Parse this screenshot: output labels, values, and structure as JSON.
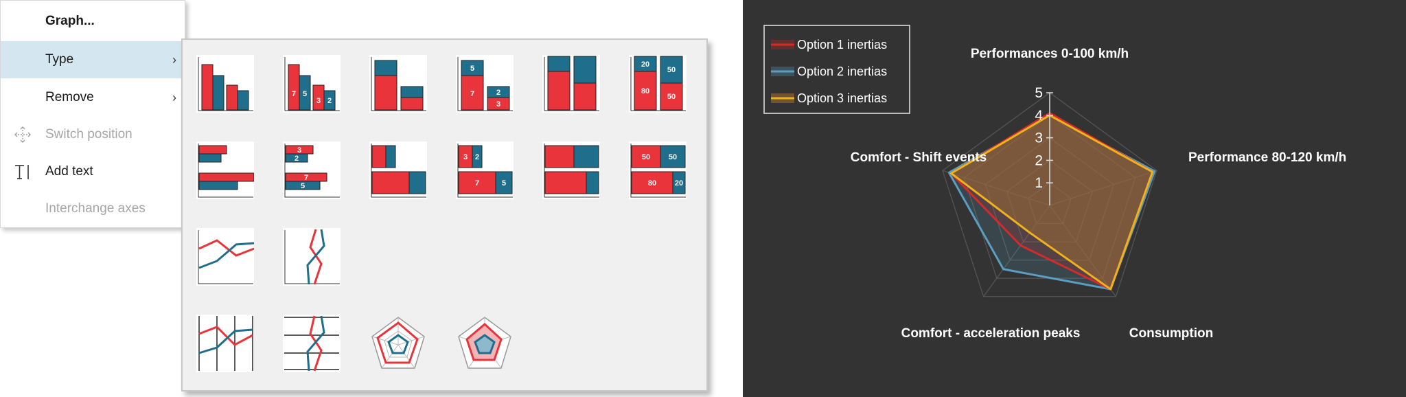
{
  "menu": {
    "items": [
      {
        "label": "Graph...",
        "name": "graph-menu-item"
      },
      {
        "label": "Type",
        "name": "type-menu-item"
      },
      {
        "label": "Remove",
        "name": "remove-menu-item"
      },
      {
        "label": "Switch position",
        "name": "switch-position-menu-item"
      },
      {
        "label": "Add text",
        "name": "add-text-menu-item"
      },
      {
        "label": "Interchange axes",
        "name": "interchange-axes-menu-item"
      }
    ],
    "submenu_arrow": "›",
    "icons": {
      "switch_position": "move-arrows-icon",
      "add_text": "text-cursor-icon",
      "submenu": "chevron-right-icon"
    }
  },
  "type_submenu": {
    "thumbnails": [
      {
        "name": "grouped-column-chart-type",
        "labels": []
      },
      {
        "name": "grouped-column-labeled-chart-type",
        "labels": [
          "7",
          "5",
          "3",
          "2"
        ]
      },
      {
        "name": "stacked-column-chart-type",
        "labels": []
      },
      {
        "name": "stacked-column-labeled-chart-type",
        "labels": [
          "5",
          "7",
          "2",
          "3"
        ]
      },
      {
        "name": "stacked-column-100-chart-type",
        "labels": []
      },
      {
        "name": "stacked-column-100-labeled-chart-type",
        "labels": [
          "20",
          "80",
          "50",
          "50"
        ]
      },
      {
        "name": "grouped-bar-chart-type",
        "labels": []
      },
      {
        "name": "grouped-bar-labeled-chart-type",
        "labels": [
          "3",
          "2",
          "7",
          "5"
        ]
      },
      {
        "name": "stacked-bar-chart-type",
        "labels": []
      },
      {
        "name": "stacked-bar-labeled-chart-type",
        "labels": [
          "3",
          "2",
          "7",
          "5"
        ]
      },
      {
        "name": "stacked-bar-100-chart-type",
        "labels": []
      },
      {
        "name": "stacked-bar-100-labeled-chart-type",
        "labels": [
          "50",
          "50",
          "80",
          "20"
        ]
      },
      {
        "name": "line-chart-type",
        "labels": []
      },
      {
        "name": "vertical-line-chart-type",
        "labels": []
      },
      {
        "name": "parallel-coordinates-chart-type",
        "labels": []
      },
      {
        "name": "vertical-parallel-coordinates-chart-type",
        "labels": []
      },
      {
        "name": "radar-chart-type",
        "labels": []
      },
      {
        "name": "filled-radar-chart-type",
        "labels": []
      }
    ]
  },
  "colors": {
    "red": "#e8343a",
    "blue": "#1f6e8c",
    "panel_bg": "#333333",
    "option1": "#d42a2a",
    "option2": "#5a9ec2",
    "option3": "#f0b21a",
    "fill": "#9a6a34"
  },
  "chart_data": {
    "type": "radar",
    "axes": [
      "Performances 0-100 km/h",
      "Performance 80-120 km/h",
      "Consumption",
      "Comfort - acceleration peaks",
      "Comfort - Shift events"
    ],
    "scale_ticks": [
      "1",
      "2",
      "3",
      "4",
      "5"
    ],
    "rmax": 5,
    "legend_position": "top-left",
    "series": [
      {
        "name": "Option 1 inertias",
        "values": [
          4.1,
          4.8,
          4.6,
          2.2,
          4.6
        ]
      },
      {
        "name": "Option 2 inertias",
        "values": [
          4.0,
          4.9,
          4.6,
          3.5,
          4.7
        ]
      },
      {
        "name": "Option 3 inertias",
        "values": [
          4.0,
          4.8,
          4.6,
          1.5,
          4.6
        ]
      }
    ]
  }
}
